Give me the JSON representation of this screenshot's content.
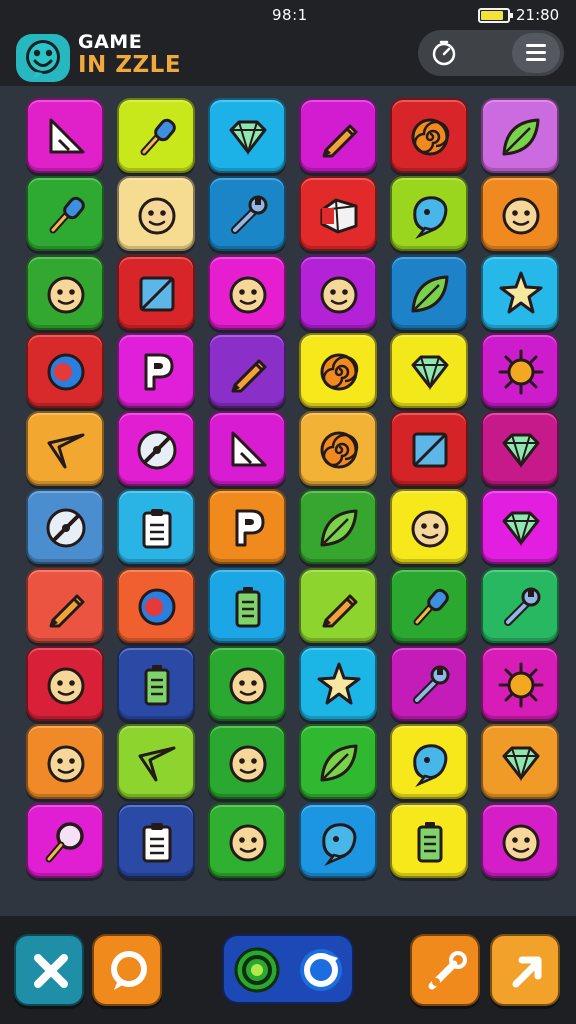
{
  "status_bar": {
    "center_text": "98:1",
    "right_text": "21:80",
    "battery_level": 0.85
  },
  "header": {
    "title_line1": "GAME",
    "title_line2": "IN ZZLE",
    "logo_icon": "smiley-face-icon"
  },
  "controls": {
    "timer_icon": "timer-icon",
    "menu_icon": "hamburger-menu-icon"
  },
  "grid": {
    "rows": 10,
    "cols": 6,
    "tiles": [
      {
        "color": "#e020c8",
        "icon": "triangle"
      },
      {
        "color": "#c8e81c",
        "icon": "brush"
      },
      {
        "color": "#1cb2e8",
        "icon": "gem"
      },
      {
        "color": "#d21cd0",
        "icon": "pencil"
      },
      {
        "color": "#d8252a",
        "icon": "spiral"
      },
      {
        "color": "#cc6ae0",
        "icon": "leaf"
      },
      {
        "color": "#2eaa33",
        "icon": "brush"
      },
      {
        "color": "#f6dc90",
        "icon": "face"
      },
      {
        "color": "#1a86c8",
        "icon": "wrench"
      },
      {
        "color": "#e22a2a",
        "icon": "diamond"
      },
      {
        "color": "#9ad61e",
        "icon": "blob"
      },
      {
        "color": "#f08a20",
        "icon": "face"
      },
      {
        "color": "#33a830",
        "icon": "face"
      },
      {
        "color": "#d8252a",
        "icon": "square"
      },
      {
        "color": "#e51ed0",
        "icon": "face"
      },
      {
        "color": "#b322d6",
        "icon": "face"
      },
      {
        "color": "#1d82c8",
        "icon": "leaf"
      },
      {
        "color": "#25b8e8",
        "icon": "star"
      },
      {
        "color": "#d82a2a",
        "icon": "circle"
      },
      {
        "color": "#e020d8",
        "icon": "letter-p"
      },
      {
        "color": "#8a2fc8",
        "icon": "pencil"
      },
      {
        "color": "#f6e81a",
        "icon": "spiral"
      },
      {
        "color": "#f2e81a",
        "icon": "gem"
      },
      {
        "color": "#cc1ccc",
        "icon": "sun"
      },
      {
        "color": "#f2a830",
        "icon": "arrow"
      },
      {
        "color": "#e21ed2",
        "icon": "compass"
      },
      {
        "color": "#d81cd2",
        "icon": "triangle"
      },
      {
        "color": "#f2b236",
        "icon": "spiral"
      },
      {
        "color": "#d42428",
        "icon": "square"
      },
      {
        "color": "#c61a8a",
        "icon": "gem"
      },
      {
        "color": "#4a8ed0",
        "icon": "compass"
      },
      {
        "color": "#2ab4e6",
        "icon": "clipboard"
      },
      {
        "color": "#f08a1c",
        "icon": "letter-p"
      },
      {
        "color": "#36a62e",
        "icon": "leaf"
      },
      {
        "color": "#f6e81a",
        "icon": "face"
      },
      {
        "color": "#e21ee0",
        "icon": "gem"
      },
      {
        "color": "#ea5440",
        "icon": "pencil"
      },
      {
        "color": "#f0602e",
        "icon": "circle"
      },
      {
        "color": "#1ca6e6",
        "icon": "battery"
      },
      {
        "color": "#8ed42e",
        "icon": "pencil"
      },
      {
        "color": "#2aa830",
        "icon": "brush"
      },
      {
        "color": "#28b862",
        "icon": "wrench"
      },
      {
        "color": "#d82038",
        "icon": "face"
      },
      {
        "color": "#2a4aa6",
        "icon": "battery"
      },
      {
        "color": "#2aa830",
        "icon": "face"
      },
      {
        "color": "#1cb6e6",
        "icon": "star"
      },
      {
        "color": "#c41cb8",
        "icon": "wrench"
      },
      {
        "color": "#d81cb8",
        "icon": "sun"
      },
      {
        "color": "#f08a28",
        "icon": "face"
      },
      {
        "color": "#8ed42e",
        "icon": "arrow"
      },
      {
        "color": "#2aa830",
        "icon": "face"
      },
      {
        "color": "#30b830",
        "icon": "leaf"
      },
      {
        "color": "#f6e81a",
        "icon": "blob"
      },
      {
        "color": "#f09a28",
        "icon": "gem"
      },
      {
        "color": "#e01ed2",
        "icon": "magnifier"
      },
      {
        "color": "#2a4aa6",
        "icon": "clipboard"
      },
      {
        "color": "#30b030",
        "icon": "face"
      },
      {
        "color": "#1c96e0",
        "icon": "blob"
      },
      {
        "color": "#f6e81a",
        "icon": "battery"
      },
      {
        "color": "#d41ec8",
        "icon": "face"
      }
    ]
  },
  "toolbar": {
    "buttons": [
      {
        "name": "close-button",
        "icon": "close-icon",
        "color": "#1f8fa8"
      },
      {
        "name": "search-button",
        "icon": "speech-bubble-icon",
        "color": "#f08a1c"
      },
      {
        "name": "target-button",
        "icon": "target-icon",
        "color": "#2aa830"
      },
      {
        "name": "refresh-button",
        "icon": "refresh-icon",
        "color": "#1c49b6"
      },
      {
        "name": "tool-button",
        "icon": "wrench-icon",
        "color": "#f08a1c"
      },
      {
        "name": "next-button",
        "icon": "arrow-icon",
        "color": "#f2a22a"
      }
    ]
  }
}
